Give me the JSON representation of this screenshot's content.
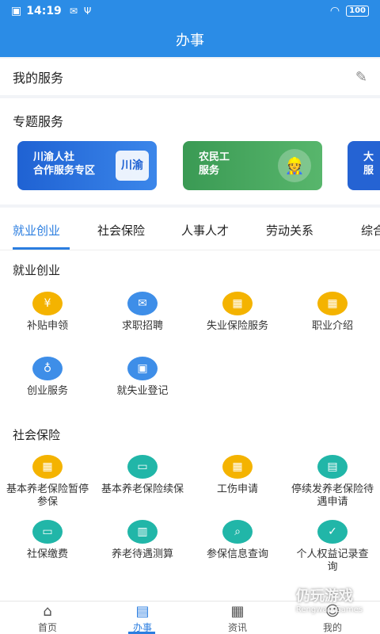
{
  "statusbar": {
    "time": "14:19",
    "battery": "100"
  },
  "header": {
    "title": "办事"
  },
  "my_service": {
    "title": "我的服务"
  },
  "topic": {
    "title": "专题服务",
    "cards": [
      {
        "line1": "川渝人社",
        "line2": "合作服务专区",
        "emblem": "川渝"
      },
      {
        "line1": "农民工",
        "line2": "服务"
      },
      {
        "line1": "大",
        "line2": "服"
      }
    ]
  },
  "tabs": [
    "就业创业",
    "社会保险",
    "人事人才",
    "劳动关系",
    "综合"
  ],
  "groups": [
    {
      "title": "就业创业",
      "items": [
        {
          "label": "补贴申领",
          "icon": "subsidy-icon"
        },
        {
          "label": "求职招聘",
          "icon": "job-icon"
        },
        {
          "label": "失业保险服务",
          "icon": "box-icon"
        },
        {
          "label": "职业介绍",
          "icon": "box-icon"
        },
        {
          "label": "创业服务",
          "icon": "money-bag-icon"
        },
        {
          "label": "就失业登记",
          "icon": "briefcase-icon"
        }
      ]
    },
    {
      "title": "社会保险",
      "items": [
        {
          "label": "基本养老保险暂停参保",
          "icon": "box-icon"
        },
        {
          "label": "基本养老保险续保",
          "icon": "card-icon"
        },
        {
          "label": "工伤申请",
          "icon": "box-icon"
        },
        {
          "label": "停续发养老保险待遇申请",
          "icon": "doc-icon"
        },
        {
          "label": "社保缴费",
          "icon": "payment-icon"
        },
        {
          "label": "养老待遇测算",
          "icon": "calc-icon"
        },
        {
          "label": "参保信息查询",
          "icon": "search-card-icon"
        },
        {
          "label": "个人权益记录查询",
          "icon": "shield-icon"
        }
      ]
    }
  ],
  "nav": [
    "首页",
    "办事",
    "资讯",
    "我的"
  ],
  "watermark": {
    "cn": "仍玩游戏",
    "en": "Rengwan Games"
  }
}
